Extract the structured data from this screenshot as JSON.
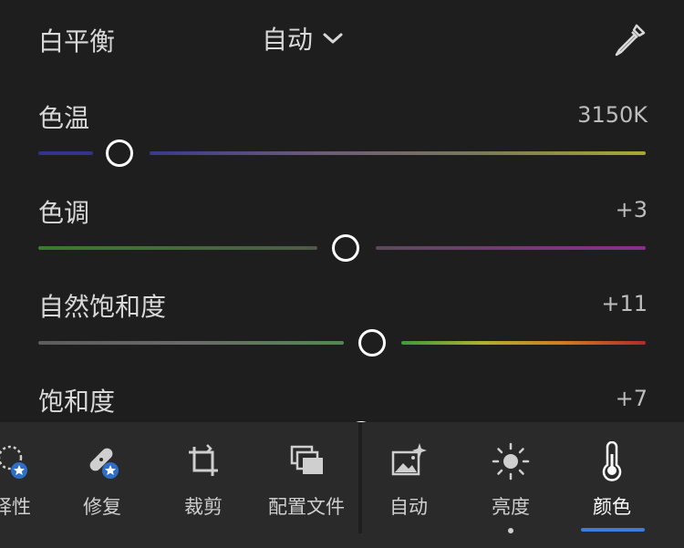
{
  "white_balance": {
    "label": "白平衡",
    "mode": "自动"
  },
  "sliders": [
    {
      "label": "色温",
      "value": "3150K",
      "position": 0.135
    },
    {
      "label": "色调",
      "value": "+3",
      "position": 0.509
    },
    {
      "label": "自然饱和度",
      "value": "+11",
      "position": 0.553
    },
    {
      "label": "饱和度",
      "value": "+7",
      "position": 0.535
    }
  ],
  "toolbar": {
    "items": [
      {
        "label": "择性",
        "icon": "selective-icon"
      },
      {
        "label": "修复",
        "icon": "bandage-icon"
      },
      {
        "label": "裁剪",
        "icon": "crop-icon"
      },
      {
        "label": "配置文件",
        "icon": "profiles-icon"
      },
      {
        "label": "自动",
        "icon": "auto-image-icon"
      },
      {
        "label": "亮度",
        "icon": "sun-icon"
      },
      {
        "label": "颜色",
        "icon": "thermometer-icon"
      }
    ],
    "active": "颜色"
  },
  "colors": {
    "accent": "#3b7ddd",
    "background": "#1e1e1e",
    "toolbar": "#2a2a2a"
  }
}
